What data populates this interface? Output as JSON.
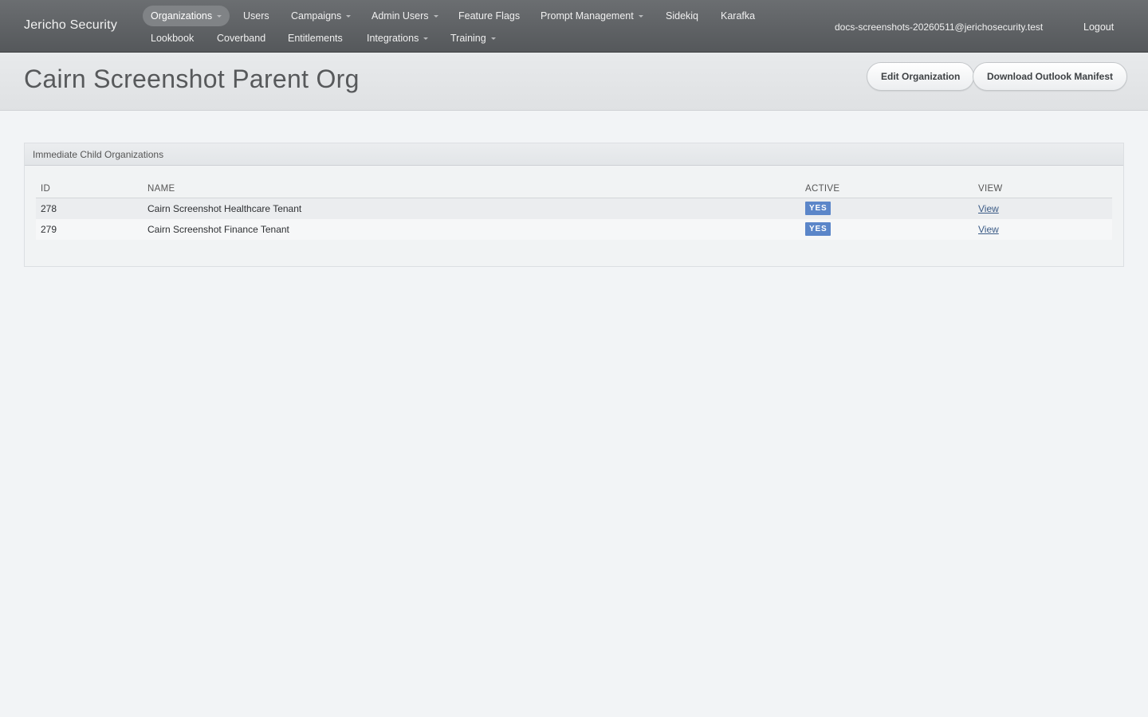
{
  "app": {
    "brand": "Jericho Security"
  },
  "nav": {
    "row1": [
      {
        "label": "Organizations",
        "dropdown": true,
        "active": true
      },
      {
        "label": "Users",
        "dropdown": false
      },
      {
        "label": "Campaigns",
        "dropdown": true
      },
      {
        "label": "Admin Users",
        "dropdown": true
      },
      {
        "label": "Feature Flags",
        "dropdown": false
      },
      {
        "label": "Prompt Management",
        "dropdown": true
      },
      {
        "label": "Sidekiq",
        "dropdown": false
      },
      {
        "label": "Karafka",
        "dropdown": false
      }
    ],
    "row2": [
      {
        "label": "Lookbook",
        "dropdown": false
      },
      {
        "label": "Coverband",
        "dropdown": false
      },
      {
        "label": "Entitlements",
        "dropdown": false
      },
      {
        "label": "Integrations",
        "dropdown": true
      },
      {
        "label": "Training",
        "dropdown": true
      }
    ],
    "user_email": "docs-screenshots-20260511@jerichosecurity.test",
    "logout": "Logout"
  },
  "header": {
    "title": "Cairn Screenshot Parent Org",
    "edit_button": "Edit Organization",
    "download_button": "Download Outlook Manifest"
  },
  "panel": {
    "heading": "Immediate Child Organizations",
    "columns": [
      "ID",
      "NAME",
      "ACTIVE",
      "VIEW"
    ],
    "rows": [
      {
        "id": "278",
        "name": "Cairn Screenshot Healthcare Tenant",
        "active": "YES",
        "view": "View"
      },
      {
        "id": "279",
        "name": "Cairn Screenshot Finance Tenant",
        "active": "YES",
        "view": "View"
      }
    ]
  },
  "colors": {
    "nav_bg": "#5f6265",
    "badge_blue": "#5b86c9",
    "link_blue": "#3b5b86",
    "page_bg": "#f2f4f6"
  }
}
